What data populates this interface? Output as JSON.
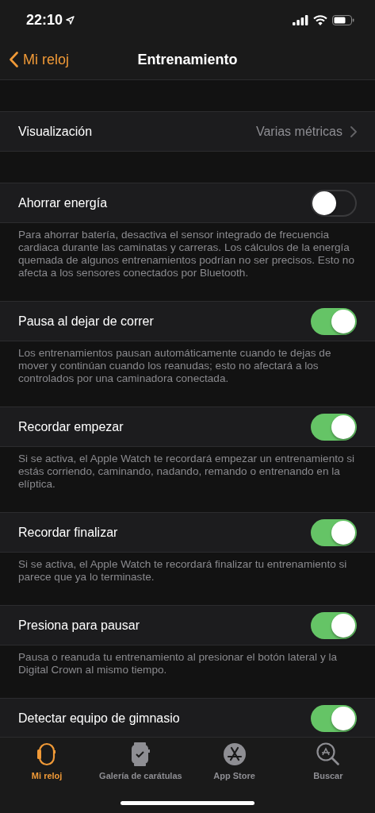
{
  "status_bar": {
    "time": "22:10"
  },
  "nav": {
    "back": "Mi reloj",
    "title": "Entrenamiento"
  },
  "settings": [
    {
      "kind": "link",
      "label": "Visualización",
      "value": "Varias métricas"
    },
    {
      "kind": "toggle",
      "label": "Ahorrar energía",
      "on": false,
      "footer": "Para ahorrar batería, desactiva el sensor integrado de frecuencia cardiaca durante las caminatas y carreras. Los cálculos de la energía quemada de algunos entrenamientos podrían no ser precisos. Esto no afecta a los sensores conectados por Bluetooth."
    },
    {
      "kind": "toggle",
      "label": "Pausa al dejar de correr",
      "on": true,
      "footer": "Los entrenamientos pausan automáticamente cuando te dejas de mover y continúan cuando los reanudas; esto no afectará a los controlados por una caminadora conectada."
    },
    {
      "kind": "toggle",
      "label": "Recordar empezar",
      "on": true,
      "footer": "Si se activa, el Apple Watch te recordará empezar un entrenamiento si estás corriendo, caminando, nadando, remando o entrenando en la elíptica."
    },
    {
      "kind": "toggle",
      "label": "Recordar finalizar",
      "on": true,
      "footer": "Si se activa, el Apple Watch te recordará finalizar tu entrenamiento si parece que ya lo terminaste."
    },
    {
      "kind": "toggle",
      "label": "Presiona para pausar",
      "on": true,
      "footer": "Pausa o reanuda tu entrenamiento al presionar el botón lateral y la Digital Crown al mismo tiempo."
    },
    {
      "kind": "toggle",
      "label": "Detectar equipo de gimnasio",
      "on": true
    }
  ],
  "tab_bar": [
    {
      "label": "Mi reloj",
      "selected": true
    },
    {
      "label": "Galería de carátulas",
      "selected": false
    },
    {
      "label": "App Store",
      "selected": false
    },
    {
      "label": "Buscar",
      "selected": false
    }
  ]
}
